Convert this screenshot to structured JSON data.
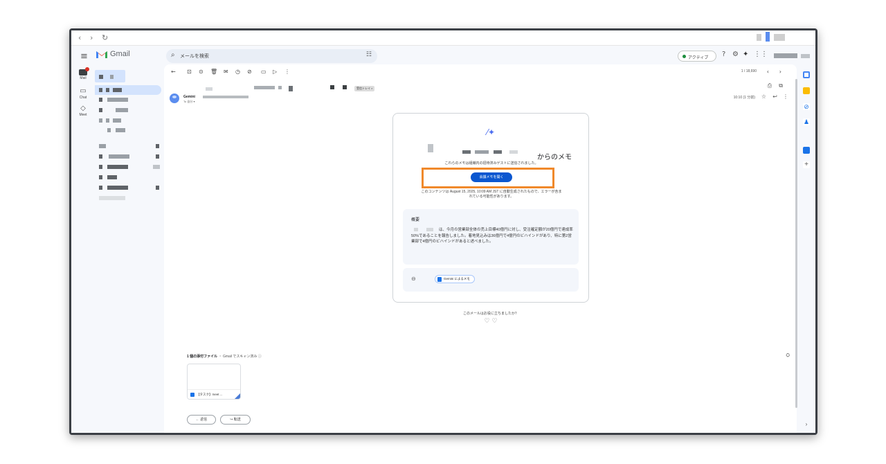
{
  "browser": {
    "back": "‹",
    "forward": "›",
    "reload": "↻"
  },
  "header": {
    "menu": "≡",
    "app_name": "Gmail",
    "search_placeholder": "メールを検索",
    "status": "アクティブ",
    "icons": [
      "help-icon",
      "gear-icon",
      "gemini-icon",
      "apps-icon"
    ]
  },
  "rail": [
    {
      "label": "Mail"
    },
    {
      "label": "Chat"
    },
    {
      "label": "Meet"
    }
  ],
  "toolbar": {
    "back": "←",
    "pager": "1 / 18,690",
    "prev": "‹",
    "next": "›"
  },
  "message": {
    "label": "受信トレイ ×",
    "sender": "Gemini",
    "to": "To 自分 ▾",
    "time": "10:10 (1 分前)"
  },
  "card": {
    "title_suffix": "からのメモ",
    "subtitle": "これらのメモは組織内の招待済みゲストに送信されました。",
    "open_button": "会議メモを開く",
    "disclaimer": "このコンテンツは August 15, 2025, 10:09 AM JST に自動生成されたもので、エラーが含まれている可能性があります。",
    "summary_heading": "概要",
    "summary_body": "は、今月の営業部全体の売上目標40億円に対し、受注確定額が20億円で達成率50%であることを報告しました。着地見込みは36億円で4億円のビハインドがあり、特に第2営業部で4億円のビハインドがあると述べました。",
    "notes_chip": "Gemini によるメモ"
  },
  "feedback": {
    "question": "このメールはお役に立ちましたか？"
  },
  "attachments": {
    "heading": "1 個の添付ファイル",
    "scanned": "・ Gmail でスキャン済み ⓘ",
    "file_name": "【タスク】meet ..."
  },
  "actions": {
    "reply": "← 返信",
    "forward": "↪ 転送"
  },
  "colors": {
    "primary": "#0b57d0",
    "highlight": "#f0892b",
    "active_dot": "#1e8e3e"
  }
}
